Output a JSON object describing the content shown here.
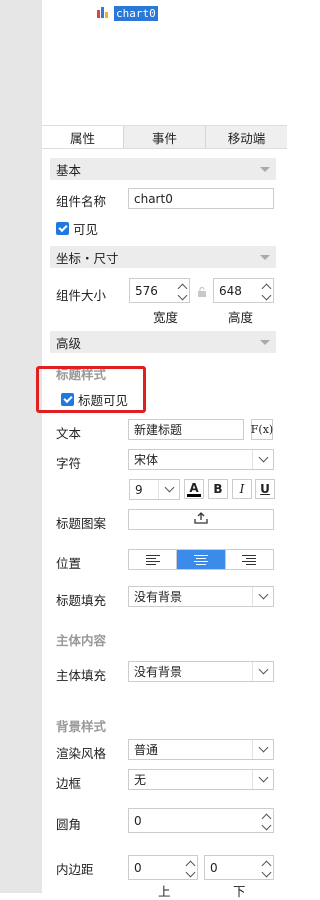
{
  "tree": {
    "node_label": "chart0"
  },
  "tabs": [
    {
      "label": "属性"
    },
    {
      "label": "事件"
    },
    {
      "label": "移动端"
    }
  ],
  "sections": {
    "basic": "基本",
    "position_size": "坐标・尺寸",
    "advanced": "高级"
  },
  "basic": {
    "name_label": "组件名称",
    "name_value": "chart0",
    "visible_label": "可见"
  },
  "position_size": {
    "size_label": "组件大小",
    "width_value": "576",
    "height_value": "648",
    "width_caption": "宽度",
    "height_caption": "高度"
  },
  "title_style": {
    "group_label": "标题样式",
    "visible_label": "标题可见",
    "text_label": "文本",
    "text_value": "新建标题",
    "formula_button": "F(x)",
    "font_label": "字符",
    "font_value": "宋体",
    "font_size_value": "9",
    "bold_label": "B",
    "italic_label": "I",
    "underline_label": "U",
    "color_label": "A",
    "pattern_label": "标题图案",
    "position_label": "位置",
    "fill_label": "标题填充",
    "fill_value": "没有背景"
  },
  "body_content": {
    "group_label": "主体内容",
    "fill_label": "主体填充",
    "fill_value": "没有背景"
  },
  "background_style": {
    "group_label": "背景样式",
    "render_label": "渲染风格",
    "render_value": "普通",
    "border_label": "边框",
    "border_value": "无",
    "radius_label": "圆角",
    "radius_value": "0",
    "padding_label": "内边距",
    "padding_top_value": "0",
    "padding_bottom_value": "0",
    "padding_top_caption": "上",
    "padding_bottom_caption": "下"
  },
  "colors": {
    "accent": "#1f7ae0",
    "highlight_box": "#e02020",
    "selected_align": "#3b8beb"
  }
}
